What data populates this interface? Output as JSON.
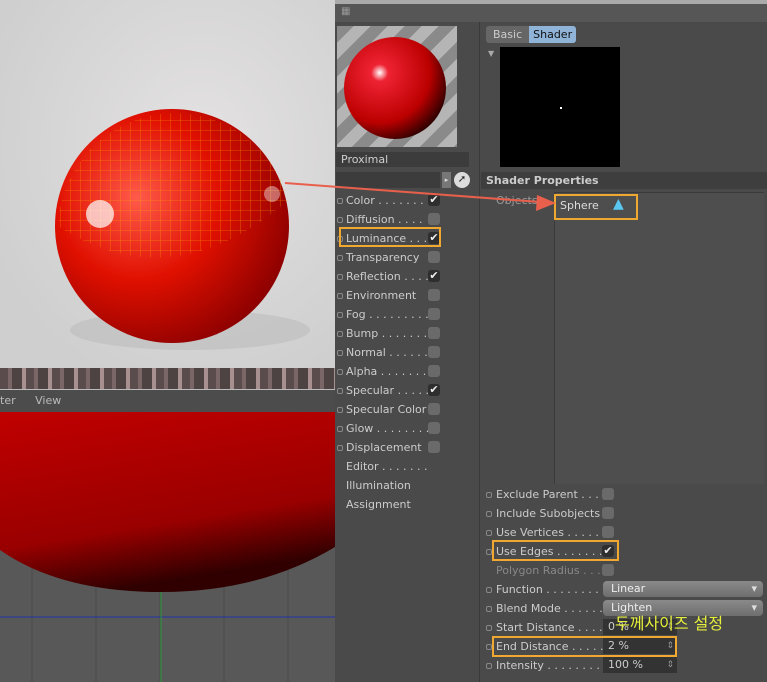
{
  "viewport": {
    "menu": [
      "ter",
      "View"
    ]
  },
  "material": {
    "name": "Proximal",
    "channels": [
      {
        "label": "Color . . . . . . . .",
        "checked": true,
        "box": true
      },
      {
        "label": "Diffusion . . . .",
        "checked": false,
        "box": true
      },
      {
        "label": "Luminance . . . .",
        "checked": true,
        "box": true
      },
      {
        "label": "Transparency",
        "checked": false,
        "box": true
      },
      {
        "label": "Reflection . . . .",
        "checked": true,
        "box": true
      },
      {
        "label": "Environment",
        "checked": false,
        "box": true
      },
      {
        "label": "Fog . . . . . . . . .",
        "checked": false,
        "box": true
      },
      {
        "label": "Bump . . . . . . . .",
        "checked": false,
        "box": true
      },
      {
        "label": "Normal . . . . . .",
        "checked": false,
        "box": true
      },
      {
        "label": "Alpha . . . . . . .",
        "checked": false,
        "box": true
      },
      {
        "label": "Specular . . . . .",
        "checked": true,
        "box": true
      },
      {
        "label": "Specular Color",
        "checked": false,
        "box": true
      },
      {
        "label": "Glow . . . . . . . .",
        "checked": false,
        "box": true
      },
      {
        "label": "Displacement",
        "checked": false,
        "box": true
      },
      {
        "label": "Editor . . . . . . .",
        "box": false
      },
      {
        "label": "Illumination",
        "box": false
      },
      {
        "label": "Assignment",
        "box": false
      }
    ]
  },
  "tabs": [
    {
      "label": "Basic",
      "active": false
    },
    {
      "label": "Shader",
      "active": true
    }
  ],
  "shader": {
    "section": "Shader Properties",
    "objects_label": "Objects",
    "object": "Sphere",
    "props": [
      {
        "label": "Exclude Parent . . .",
        "type": "check",
        "checked": false
      },
      {
        "label": "Include Subobjects",
        "type": "check",
        "checked": false
      },
      {
        "label": "Use Vertices . . . . . .",
        "type": "check",
        "checked": false
      },
      {
        "label": "Use Edges . . . . . . . .",
        "type": "check",
        "checked": true
      },
      {
        "label": "Polygon Radius . . .",
        "type": "check",
        "checked": false,
        "disabled": true
      },
      {
        "label": "Function . . . . . . . . . .",
        "type": "select",
        "value": "Linear"
      },
      {
        "label": "Blend Mode . . . . . . .",
        "type": "select",
        "value": "Lighten"
      },
      {
        "label": "Start Distance . . . . .",
        "type": "num",
        "value": "0 %"
      },
      {
        "label": "End Distance . . . . . .",
        "type": "num",
        "value": "2 %"
      },
      {
        "label": "Intensity . . . . . . . . . .",
        "type": "num",
        "value": "100 %"
      }
    ]
  },
  "annotation": "두께사이즈 설정",
  "colors": {
    "highlight": "#f1a831",
    "arrow": "#e8604c",
    "annotation": "#e6f03a",
    "tab_active": "#8fb4d8"
  }
}
